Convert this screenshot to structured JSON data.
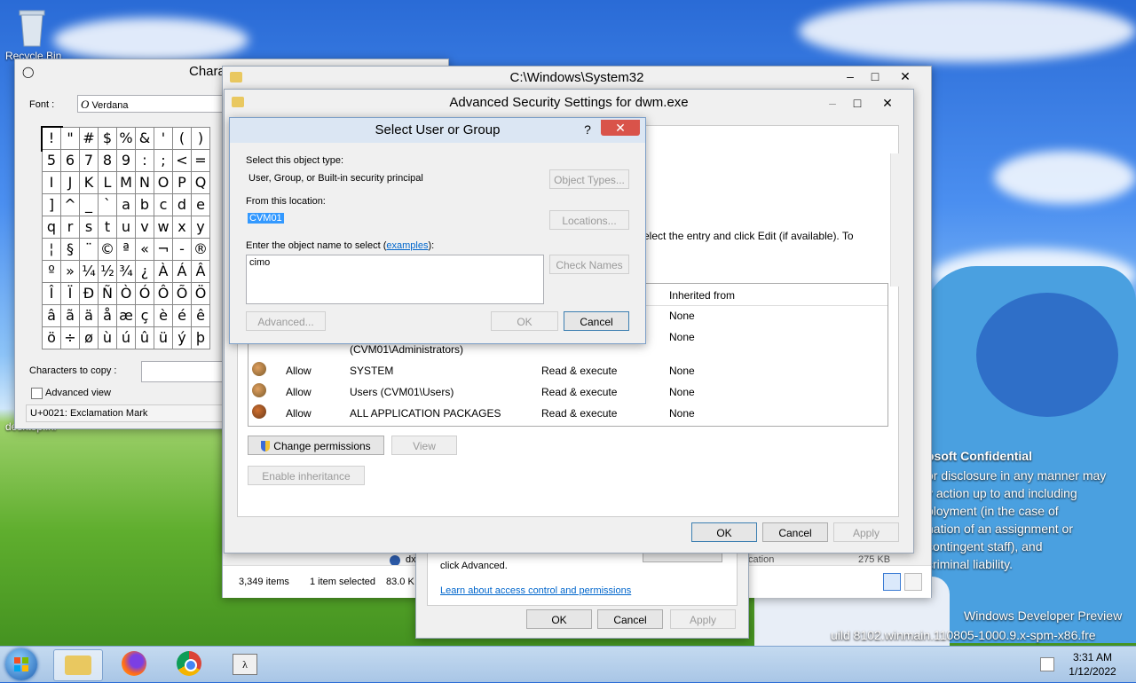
{
  "desktop": {
    "recycle_bin": "Recycle Bin",
    "desktop_ini": "desktop.ini",
    "watermark": {
      "title": "osoft Confidential",
      "lines": [
        "or disclosure in any manner may",
        "y action up to and including",
        "ployment (in the case of",
        "nation of an assignment or",
        "contingent staff), and",
        "criminal liability."
      ]
    },
    "build1": "Windows Developer Preview",
    "build2": "uild 8102.winmain.110805-1000.9.x-spm-x86.fre"
  },
  "charmap": {
    "title": "Character Map",
    "font_label": "Font :",
    "font_value": "Verdana",
    "chars": [
      "!",
      "\"",
      "#",
      "$",
      "%",
      "&",
      "'",
      "(",
      ")",
      "5",
      "6",
      "7",
      "8",
      "9",
      ":",
      ";",
      "<",
      "=",
      "I",
      "J",
      "K",
      "L",
      "M",
      "N",
      "O",
      "P",
      "Q",
      "]",
      "^",
      "_",
      "`",
      "a",
      "b",
      "c",
      "d",
      "e",
      "q",
      "r",
      "s",
      "t",
      "u",
      "v",
      "w",
      "x",
      "y",
      "¦",
      "§",
      "¨",
      "©",
      "ª",
      "«",
      "¬",
      "-",
      "®",
      "º",
      "»",
      "¼",
      "½",
      "¾",
      "¿",
      "À",
      "Á",
      "Â",
      "Î",
      "Ï",
      "Ð",
      "Ñ",
      "Ò",
      "Ó",
      "Ô",
      "Õ",
      "Ö",
      "â",
      "ã",
      "ä",
      "å",
      "æ",
      "ç",
      "è",
      "é",
      "ê",
      "ö",
      "÷",
      "ø",
      "ù",
      "ú",
      "û",
      "ü",
      "ý",
      "þ"
    ],
    "copy_label": "Characters to copy :",
    "advanced_view": "Advanced view",
    "status": "U+0021: Exclamation Mark"
  },
  "explorer": {
    "title": "C:\\Windows\\System32",
    "items_count": "3,349 items",
    "selected": "1 item selected",
    "size": "83.0 K",
    "row_name": "dx",
    "row_type": "cation",
    "row_size": "275 KB"
  },
  "advsec": {
    "title": "Advanced Security Settings for dwm.exe",
    "hint": "elect the entry and click Edit (if available). To",
    "col_inherited": "Inherited from",
    "rows": [
      {
        "type": "",
        "principal": "",
        "access": "",
        "inherited": "None"
      },
      {
        "type": "",
        "principal": "",
        "access": "",
        "inherited": "None"
      },
      {
        "type": "",
        "principal": "(CVM01\\Administrators)",
        "access": "",
        "inherited": ""
      },
      {
        "type": "Allow",
        "principal": "SYSTEM",
        "access": "Read & execute",
        "inherited": "None"
      },
      {
        "type": "Allow",
        "principal": "Users (CVM01\\Users)",
        "access": "Read & execute",
        "inherited": "None"
      },
      {
        "type": "Allow",
        "principal": "ALL APPLICATION PACKAGES",
        "access": "Read & execute",
        "inherited": "None"
      }
    ],
    "change_permissions": "Change permissions",
    "view": "View",
    "enable_inheritance": "Enable inheritance",
    "ok": "OK",
    "cancel": "Cancel",
    "apply": "Apply"
  },
  "props": {
    "click_advanced": "click Advanced.",
    "learn_link": "Learn about access control and permissions",
    "ok": "OK",
    "cancel": "Cancel",
    "apply": "Apply"
  },
  "select": {
    "title": "Select User or Group",
    "help": "?",
    "obj_type_label": "Select this object type:",
    "obj_type_value": "User, Group, or Built-in security principal",
    "object_types_btn": "Object Types...",
    "location_label": "From this location:",
    "location_value": "CVM01",
    "locations_btn": "Locations...",
    "enter_label": "Enter the object name to select (",
    "examples_link": "examples",
    "enter_label_end": "):",
    "name_value": "cimo",
    "check_names_btn": "Check Names",
    "advanced_btn": "Advanced...",
    "ok": "OK",
    "cancel": "Cancel"
  },
  "taskbar": {
    "time": "3:31 AM",
    "date": "1/12/2022"
  }
}
